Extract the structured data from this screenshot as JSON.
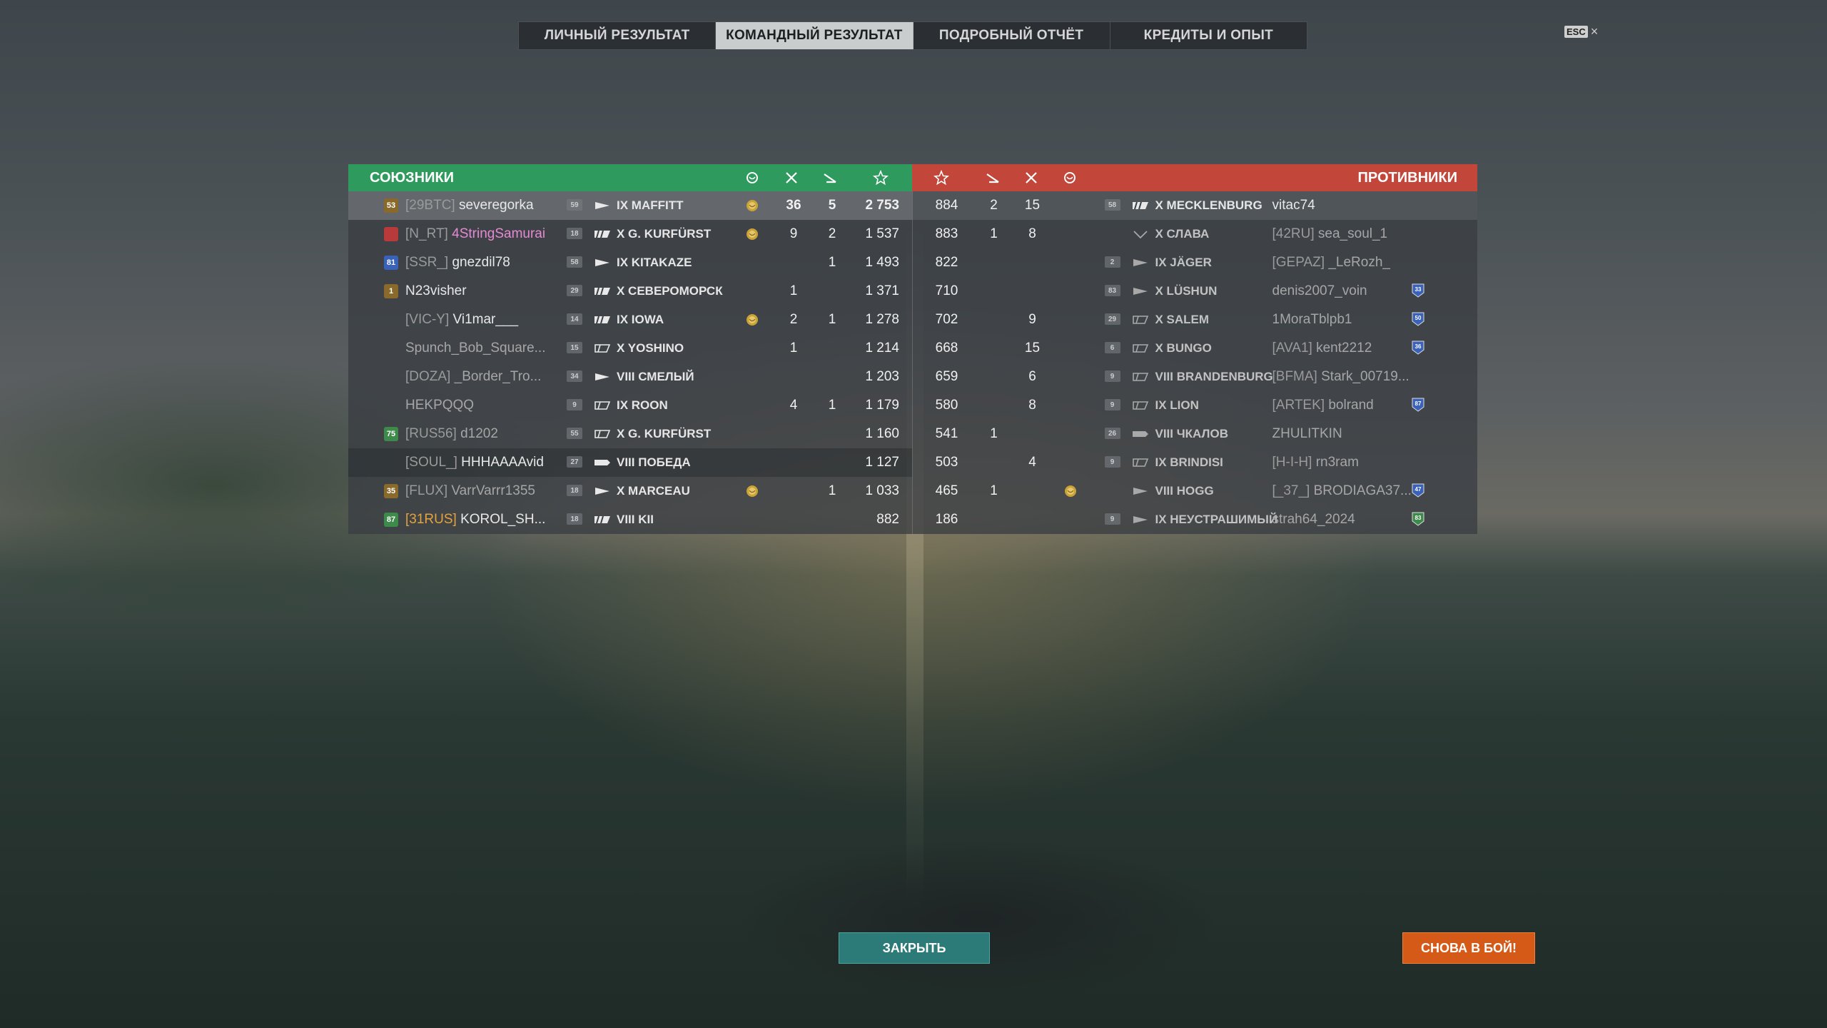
{
  "tabs": [
    {
      "label": "ЛИЧНЫЙ РЕЗУЛЬТАТ",
      "active": false
    },
    {
      "label": "КОМАНДНЫЙ РЕЗУЛЬТАТ",
      "active": true
    },
    {
      "label": "ПОДРОБНЫЙ ОТЧЁТ",
      "active": false
    },
    {
      "label": "КРЕДИТЫ И ОПЫТ",
      "active": false
    }
  ],
  "esc": {
    "key": "ESC",
    "close": "×"
  },
  "allies_title": "СОЮЗНИКИ",
  "enemies_title": "ПРОТИВНИКИ",
  "header_icons": {
    "left": [
      "medal-icon",
      "frags-icon",
      "planes-icon",
      "star-icon"
    ],
    "right": [
      "star-icon",
      "planes-icon",
      "frags-icon",
      "medal-icon"
    ]
  },
  "allies": [
    {
      "rank": "53",
      "rank_color": "#8a6a2a",
      "clan": "[29BTC]",
      "clan_color": "gray",
      "player": "severegorka",
      "player_style": "normal",
      "level": "59",
      "ship_class": "destroyer",
      "ship": "IX MAFFITT",
      "medal": true,
      "frags": "36",
      "planes": "5",
      "score": "2 753"
    },
    {
      "rank": "",
      "rank_color": "#b83a3a",
      "clan": "[N_RT]",
      "clan_color": "gray",
      "player": "4StringSamurai",
      "player_style": "pink",
      "level": "18",
      "ship_class": "battleship",
      "ship": "X G. KURFÜRST",
      "medal": true,
      "frags": "9",
      "planes": "2",
      "score": "1 537"
    },
    {
      "rank": "81",
      "rank_color": "#3a62b8",
      "clan": "[SSR_]",
      "clan_color": "gray",
      "player": "gnezdil78",
      "player_style": "normal",
      "level": "58",
      "ship_class": "destroyer",
      "ship": "IX KITAKAZE",
      "medal": false,
      "frags": "",
      "planes": "1",
      "score": "1 493"
    },
    {
      "rank": "1",
      "rank_color": "#8a6a2a",
      "clan": "",
      "clan_color": "gray",
      "player": "N23visher",
      "player_style": "normal",
      "level": "29",
      "ship_class": "battleship",
      "ship": "X СЕВЕРОМОРСК",
      "medal": false,
      "frags": "1",
      "planes": "",
      "score": "1 371"
    },
    {
      "rank": "",
      "rank_color": "",
      "clan": "[VIC-Y]",
      "clan_color": "gray",
      "player": "Vi1mar___",
      "player_style": "normal",
      "level": "14",
      "ship_class": "battleship",
      "ship": "IX IOWA",
      "medal": true,
      "frags": "2",
      "planes": "1",
      "score": "1 278"
    },
    {
      "rank": "",
      "rank_color": "",
      "clan": "",
      "clan_color": "gray",
      "player": "Spunch_Bob_Square...",
      "player_style": "dim",
      "level": "15",
      "ship_class": "cruiser",
      "ship": "X YOSHINO",
      "medal": false,
      "frags": "1",
      "planes": "",
      "score": "1 214"
    },
    {
      "rank": "",
      "rank_color": "",
      "clan": "[DOZA]",
      "clan_color": "gray",
      "player": "_Border_Tro...",
      "player_style": "dim",
      "level": "34",
      "ship_class": "destroyer",
      "ship": "VIII СМЕЛЫЙ",
      "medal": false,
      "frags": "",
      "planes": "",
      "score": "1 203"
    },
    {
      "rank": "",
      "rank_color": "",
      "clan": "",
      "clan_color": "gray",
      "player": "HEKPQQQ",
      "player_style": "dim",
      "level": "9",
      "ship_class": "cruiser",
      "ship": "IX ROON",
      "medal": false,
      "frags": "4",
      "planes": "1",
      "score": "1 179"
    },
    {
      "rank": "75",
      "rank_color": "#3d8a4a",
      "clan": "[RUS56]",
      "clan_color": "gray",
      "player": "d1202",
      "player_style": "dim",
      "level": "55",
      "ship_class": "cruiser",
      "ship": "X G. KURFÜRST",
      "medal": false,
      "frags": "",
      "planes": "",
      "score": "1 160"
    },
    {
      "rank": "",
      "rank_color": "",
      "clan": "[SOUL_]",
      "clan_color": "gray",
      "player": "HHHAAAAvid",
      "player_style": "normal",
      "level": "27",
      "ship_class": "carrier",
      "ship": "VIII ПОБЕДА",
      "medal": false,
      "frags": "",
      "planes": "",
      "score": "1 127"
    },
    {
      "rank": "35",
      "rank_color": "#8a6a2a",
      "clan": "[FLUX]",
      "clan_color": "gray",
      "player": "VarrVarrr1355",
      "player_style": "dim",
      "level": "18",
      "ship_class": "destroyer",
      "ship": "X MARCEAU",
      "medal": true,
      "frags": "",
      "planes": "1",
      "score": "1 033"
    },
    {
      "rank": "87",
      "rank_color": "#3d8a4a",
      "clan": "[31RUS]",
      "clan_color": "orange",
      "player": "KOROL_SH...",
      "player_style": "normal",
      "level": "18",
      "ship_class": "battleship",
      "ship": "VIII KII",
      "medal": false,
      "frags": "",
      "planes": "",
      "score": "882"
    }
  ],
  "enemies": [
    {
      "score": "884",
      "planes": "2",
      "frags": "15",
      "medal": false,
      "level": "58",
      "ship_class": "battleship",
      "ship": "X MECKLENBURG",
      "clan": "",
      "player": "vitac74",
      "badge": "",
      "badge_color": ""
    },
    {
      "score": "883",
      "planes": "1",
      "frags": "8",
      "medal": false,
      "level": "",
      "ship_class": "submarine",
      "ship": "X СЛАВА",
      "clan": "[42RU]",
      "player": "sea_soul_1",
      "badge": "",
      "badge_color": ""
    },
    {
      "score": "822",
      "planes": "",
      "frags": "",
      "medal": false,
      "level": "2",
      "ship_class": "destroyer",
      "ship": "IX JÄGER",
      "clan": "[GEPAZ]",
      "player": "_LeRozh_",
      "badge": "",
      "badge_color": ""
    },
    {
      "score": "710",
      "planes": "",
      "frags": "",
      "medal": false,
      "level": "83",
      "ship_class": "destroyer",
      "ship": "X LÜSHUN",
      "clan": "",
      "player": "denis2007_voin",
      "badge": "33",
      "badge_color": "#3a62b8"
    },
    {
      "score": "702",
      "planes": "",
      "frags": "9",
      "medal": false,
      "level": "29",
      "ship_class": "cruiser",
      "ship": "X SALEM",
      "clan": "",
      "player": "1MoraTblpb1",
      "badge": "50",
      "badge_color": "#3a62b8"
    },
    {
      "score": "668",
      "planes": "",
      "frags": "15",
      "medal": false,
      "level": "6",
      "ship_class": "cruiser",
      "ship": "X BUNGO",
      "clan": "[AVA1]",
      "player": "kent2212",
      "badge": "36",
      "badge_color": "#3a62b8"
    },
    {
      "score": "659",
      "planes": "",
      "frags": "6",
      "medal": false,
      "level": "9",
      "ship_class": "cruiser",
      "ship": "VIII BRANDENBURG",
      "clan": "[BFMA]",
      "player": "Stark_00719...",
      "badge": "",
      "badge_color": ""
    },
    {
      "score": "580",
      "planes": "",
      "frags": "8",
      "medal": false,
      "level": "9",
      "ship_class": "cruiser",
      "ship": "IX LION",
      "clan": "[ARTEK]",
      "player": "bolrand",
      "badge": "87",
      "badge_color": "#3a62b8"
    },
    {
      "score": "541",
      "planes": "1",
      "frags": "",
      "medal": false,
      "level": "26",
      "ship_class": "carrier",
      "ship": "VIII ЧКАЛОВ",
      "clan": "",
      "player": "ZHULITKIN",
      "badge": "",
      "badge_color": ""
    },
    {
      "score": "503",
      "planes": "",
      "frags": "4",
      "medal": false,
      "level": "9",
      "ship_class": "cruiser",
      "ship": "IX BRINDISI",
      "clan": "[H-I-H]",
      "player": "rn3ram",
      "badge": "",
      "badge_color": ""
    },
    {
      "score": "465",
      "planes": "1",
      "frags": "",
      "medal": true,
      "level": "",
      "ship_class": "destroyer",
      "ship": "VIII HOGG",
      "clan": "[_37_]",
      "player": "BRODIAGA37...",
      "badge": "47",
      "badge_color": "#3a62b8"
    },
    {
      "score": "186",
      "planes": "",
      "frags": "",
      "medal": false,
      "level": "9",
      "ship_class": "destroyer",
      "ship": "IX НЕУСТРАШИМЫЙ",
      "clan": "",
      "player": "strah64_2024",
      "badge": "83",
      "badge_color": "#3d8a4a"
    }
  ],
  "buttons": {
    "close": "ЗАКРЫТЬ",
    "again": "СНОВА В БОЙ!"
  }
}
